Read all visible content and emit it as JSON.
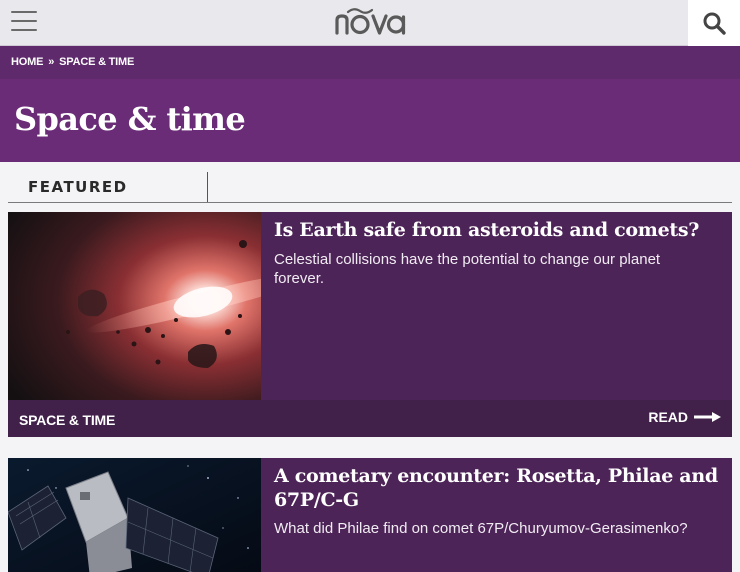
{
  "header": {
    "menu_icon": "hamburger-menu-icon",
    "logo_text": "nova",
    "search_icon": "search-icon"
  },
  "breadcrumb": {
    "home": "HOME",
    "separator": "»",
    "current": "SPACE & TIME"
  },
  "page": {
    "title": "Space & time"
  },
  "featured": {
    "label": "FEATURED"
  },
  "cards": [
    {
      "title": "Is Earth safe from asteroids and comets?",
      "description": "Celestial collisions have the potential to change our planet forever.",
      "category": "SPACE & TIME",
      "read_label": "READ"
    },
    {
      "title": "A cometary encounter: Rosetta, Philae and 67P/C-G",
      "description": "What did Philae find on comet 67P/Churyumov-Gerasimenko?"
    }
  ],
  "colors": {
    "brand_purple": "#6a2c77",
    "breadcrumb_purple": "#5e2a6c",
    "card_purple": "#4d2457",
    "card_footer": "#41204a"
  }
}
